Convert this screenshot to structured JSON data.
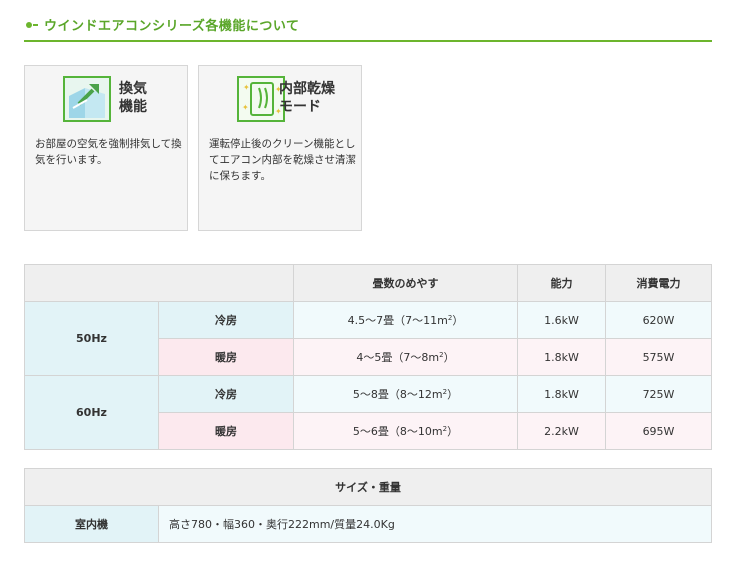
{
  "section": {
    "title": "ウインドエアコンシリーズ各機能について"
  },
  "features": [
    {
      "label": "換気\n機能",
      "description": "お部屋の空気を強制排気して換気を行います。",
      "icon": "ventilation-icon"
    },
    {
      "label": "内部乾燥\nモード",
      "description": "運転停止後のクリーン機能としてエアコン内部を乾燥させ清潔に保ちます。",
      "icon": "internal-dry-icon"
    }
  ],
  "spec_table": {
    "headers": {
      "tatami": "畳数のめやす",
      "capacity": "能力",
      "power": "消費電力"
    },
    "rows": [
      {
        "hz": "50Hz",
        "mode": "冷房",
        "tatami": "4.5～7畳（7～11m",
        "sup": "2",
        "tatami_end": "）",
        "capacity": "1.6kW",
        "power": "620W"
      },
      {
        "mode": "暖房",
        "tatami": "4～5畳（7～8m",
        "sup": "2",
        "tatami_end": "）",
        "capacity": "1.8kW",
        "power": "575W"
      },
      {
        "hz": "60Hz",
        "mode": "冷房",
        "tatami": "5～8畳（8～12m",
        "sup": "2",
        "tatami_end": "）",
        "capacity": "1.8kW",
        "power": "725W"
      },
      {
        "mode": "暖房",
        "tatami": "5～6畳（8～10m",
        "sup": "2",
        "tatami_end": "）",
        "capacity": "2.2kW",
        "power": "695W"
      }
    ]
  },
  "size_table": {
    "header": "サイズ・重量",
    "row_label": "室内機",
    "row_value": "高さ780・幅360・奥行222mm/質量24.0Kg"
  },
  "colors": {
    "accent_green": "#6cb52d",
    "cool_bg": "#e2f3f7",
    "heat_bg": "#fce9ee"
  }
}
